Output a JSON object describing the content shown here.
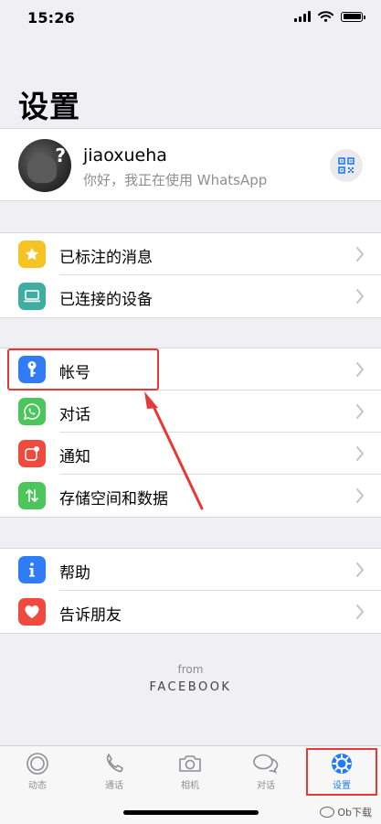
{
  "status_bar": {
    "time": "15:26"
  },
  "title": "设置",
  "profile": {
    "name": "jiaoxueha",
    "status": "你好，我正在使用 WhatsApp"
  },
  "groups": [
    {
      "items": [
        {
          "label": "已标注的消息",
          "icon": "star-icon",
          "color": "#f6c324"
        },
        {
          "label": "已连接的设备",
          "icon": "laptop-icon",
          "color": "#3fada2"
        }
      ]
    },
    {
      "items": [
        {
          "label": "帐号",
          "icon": "key-icon",
          "color": "#2f7cf6"
        },
        {
          "label": "对话",
          "icon": "whatsapp-icon",
          "color": "#4bc65a"
        },
        {
          "label": "通知",
          "icon": "notification-icon",
          "color": "#f04a3f"
        },
        {
          "label": "存储空间和数据",
          "icon": "arrows-updown-icon",
          "color": "#4bc65a"
        }
      ]
    },
    {
      "items": [
        {
          "label": "帮助",
          "icon": "info-icon",
          "color": "#2f7cf6"
        },
        {
          "label": "告诉朋友",
          "icon": "heart-icon",
          "color": "#f04a3f"
        }
      ]
    }
  ],
  "footer": {
    "from": "from",
    "brand": "FACEBOOK"
  },
  "tabs": [
    {
      "label": "动态",
      "icon": "status-icon"
    },
    {
      "label": "通话",
      "icon": "phone-icon"
    },
    {
      "label": "相机",
      "icon": "camera-icon"
    },
    {
      "label": "对话",
      "icon": "chat-bubbles-icon"
    },
    {
      "label": "设置",
      "icon": "settings-icon",
      "active": true
    }
  ],
  "watermark": "Ob下载",
  "colors": {
    "accent": "#1f7bf6",
    "annotation": "#e53935"
  }
}
